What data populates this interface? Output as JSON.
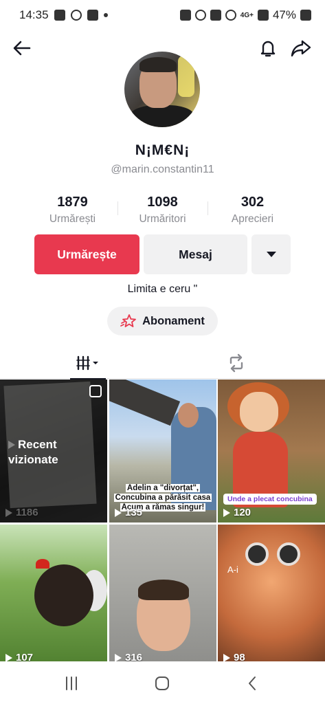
{
  "status_bar": {
    "time": "14:35",
    "network": "4G+",
    "battery": "47%"
  },
  "profile": {
    "nickname": "N¡M€N¡",
    "username": "@marin.constantin11",
    "stats": [
      {
        "value": "1879",
        "label": "Urmărești"
      },
      {
        "value": "1098",
        "label": "Urmăritori"
      },
      {
        "value": "302",
        "label": "Aprecieri"
      }
    ],
    "follow_label": "Urmărește",
    "message_label": "Mesaj",
    "bio": "Limita e ceru \"",
    "subscription_label": "Abonament"
  },
  "videos": [
    {
      "views": "1186",
      "overlay": [
        "Recent",
        "vizionate"
      ]
    },
    {
      "views": "135",
      "caption": [
        "Adelin a \"divorțat\",",
        "Concubina a părăsit casa",
        "Acum a rămas singur!"
      ]
    },
    {
      "views": "120",
      "tag": "Unde a plecat concubina"
    },
    {
      "views": "107"
    },
    {
      "views": "316"
    },
    {
      "views": "98",
      "text": "A-i"
    }
  ],
  "colors": {
    "accent": "#e8394f",
    "secondary_button": "#f1f1f2"
  }
}
